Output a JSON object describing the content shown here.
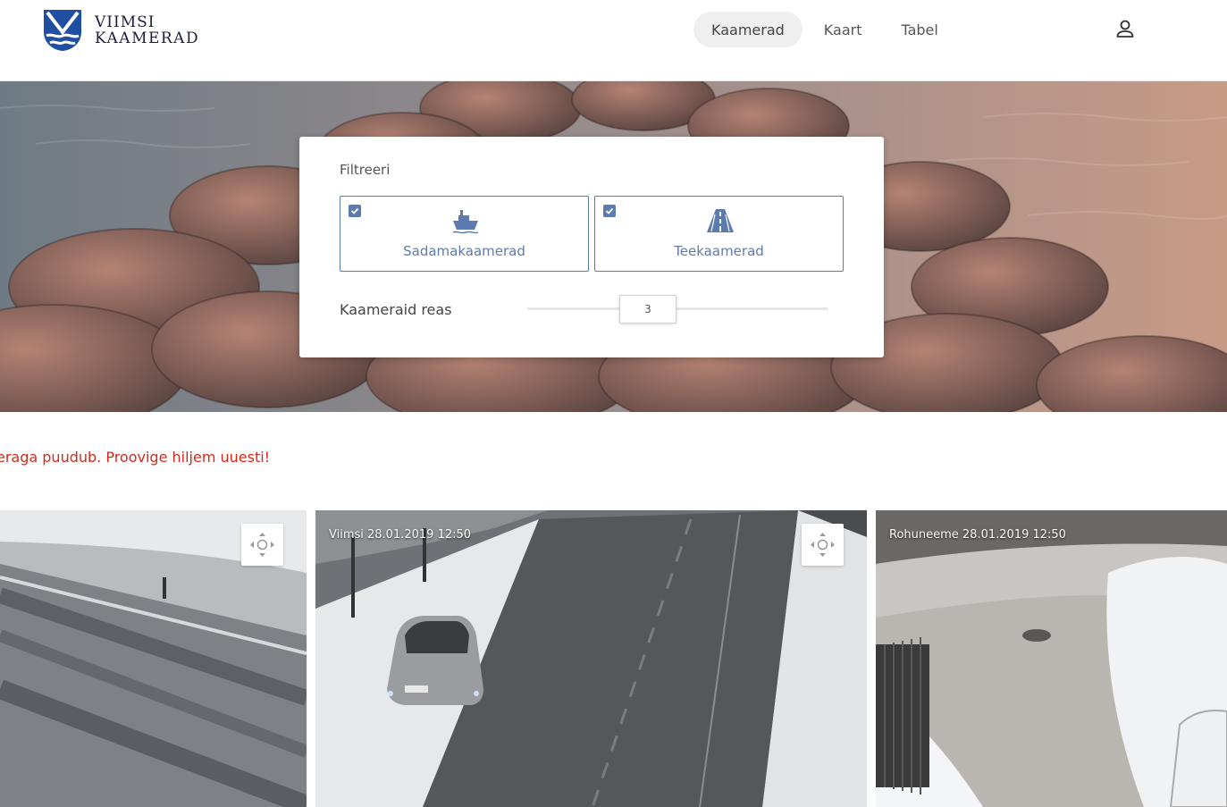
{
  "header": {
    "logo": {
      "line1": "VIIMSI",
      "line2": "KAAMERAD"
    },
    "nav": [
      {
        "label": "Kaamerad",
        "active": true
      },
      {
        "label": "Kaart",
        "active": false
      },
      {
        "label": "Tabel",
        "active": false
      }
    ],
    "user_icon": "user-icon"
  },
  "filter": {
    "title": "Filtreeri",
    "toggles": [
      {
        "label": "Sadamakaamerad",
        "checked": true,
        "icon": "ship-icon"
      },
      {
        "label": "Teekaamerad",
        "checked": true,
        "icon": "road-icon"
      }
    ],
    "slider": {
      "label": "Kaameraid reas",
      "value": "3"
    }
  },
  "error_text": "eraga puudub. Proovige hiljem uuesti!",
  "cameras": [
    {
      "caption": "",
      "ptz": true
    },
    {
      "caption": "Viimsi  28.01.2019 12:50",
      "ptz": true
    },
    {
      "caption": "Rohuneeme  28.01.2019 12:50",
      "ptz": false
    }
  ],
  "colors": {
    "accent": "#5c7bb0",
    "error": "#d42a1c",
    "logo_blue": "#1f4ea3"
  }
}
